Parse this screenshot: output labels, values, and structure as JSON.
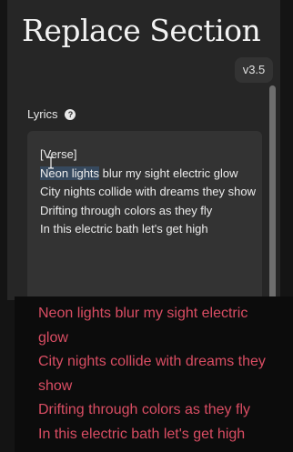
{
  "header": {
    "title": "Replace Section",
    "version": "v3.5"
  },
  "lyrics": {
    "label": "Lyrics",
    "help_glyph": "?",
    "section_tag": "[Verse]",
    "selected_text": "Neon lights",
    "line1_rest": " blur my sight electric glow",
    "lines": [
      "City nights collide with dreams they show",
      "Drifting through colors as they fly",
      "In this electric bath let's get high"
    ]
  },
  "caption": {
    "lines": [
      "Neon lights blur my sight electric glow",
      "City nights collide with dreams they show",
      "Drifting through colors as they fly",
      "In this electric bath let's get high"
    ]
  },
  "colors": {
    "caption_text": "#d94d63",
    "selection_highlight": "#36495e",
    "panel_background": "#262626"
  },
  "icons": {
    "help": "question-circle-icon",
    "cursor": "text-cursor-icon"
  }
}
